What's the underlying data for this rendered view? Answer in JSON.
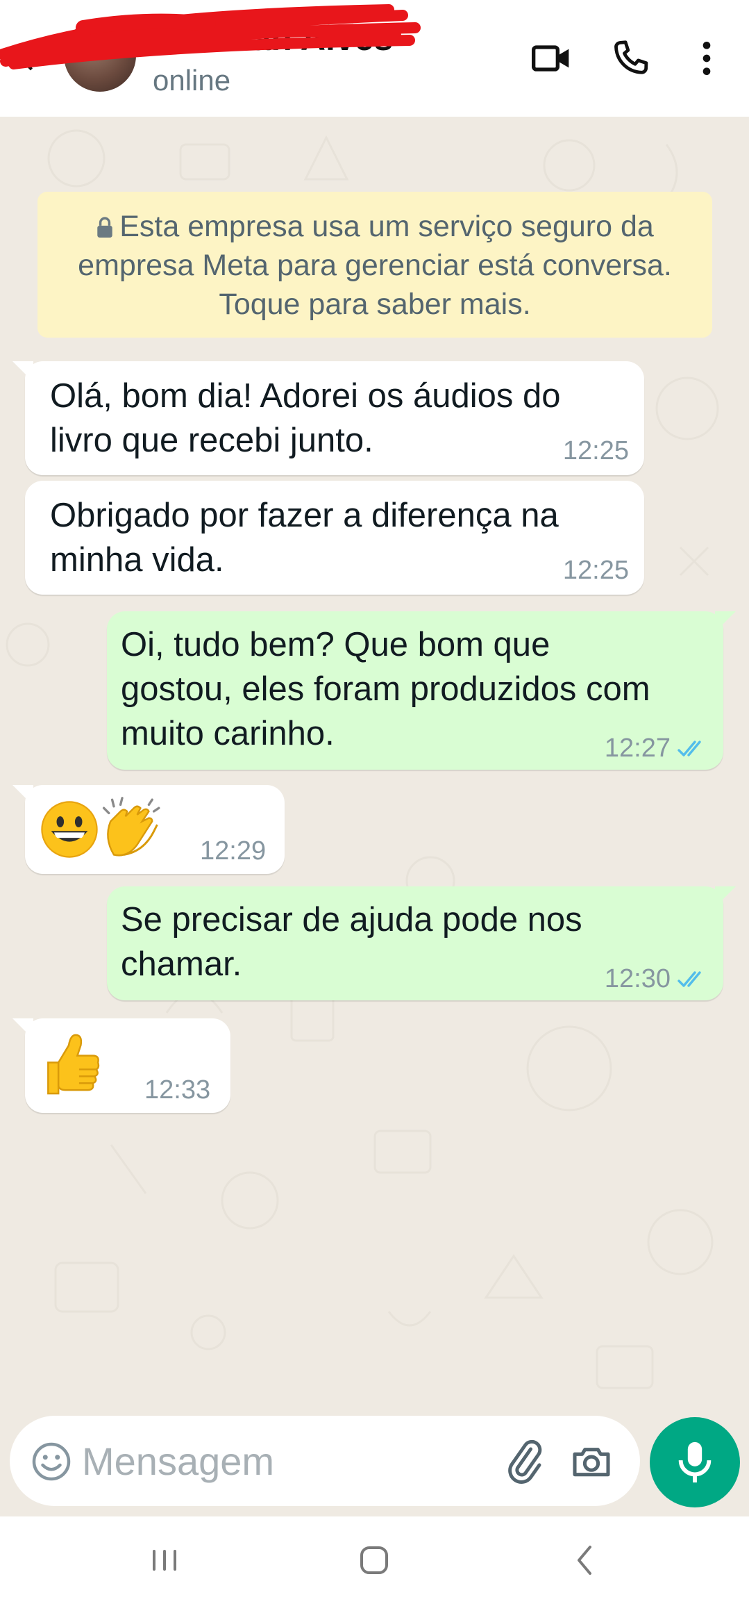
{
  "header": {
    "contact_name": "Deborah Alves",
    "status": "online",
    "icons": [
      "back-arrow-icon",
      "video-call-icon",
      "voice-call-icon",
      "more-options-icon"
    ]
  },
  "system_message": {
    "line1": "Esta empresa usa um serviço seguro da",
    "line2": "empresa Meta para gerenciar está conversa.",
    "line3": "Toque para saber mais."
  },
  "messages": [
    {
      "direction": "in",
      "lines": [
        "Olá, bom dia! Adorei os áudios do",
        "livro que recebi junto."
      ],
      "time": "12:25"
    },
    {
      "direction": "in",
      "lines": [
        "Obrigado por fazer a diferença na",
        "minha vida."
      ],
      "time": "12:25"
    },
    {
      "direction": "out",
      "lines": [
        "Oi, tudo bem? Que bom que",
        "gostou, eles foram produzidos com",
        "muito carinho."
      ],
      "time": "12:27",
      "read": true
    },
    {
      "direction": "in",
      "emoji": "grinning-face clapping-hands",
      "time": "12:29"
    },
    {
      "direction": "out",
      "lines": [
        "Se precisar de ajuda pode nos",
        "chamar."
      ],
      "time": "12:30",
      "read": true
    },
    {
      "direction": "in",
      "emoji": "thumbs-up",
      "time": "12:33"
    }
  ],
  "composer": {
    "placeholder": "Mensagem"
  },
  "colors": {
    "chat_bg": "#efeae2",
    "incoming": "#ffffff",
    "outgoing": "#d9fdd3",
    "system": "#fdf4c5",
    "accent": "#00a884",
    "read_ticks": "#53bdeb"
  }
}
